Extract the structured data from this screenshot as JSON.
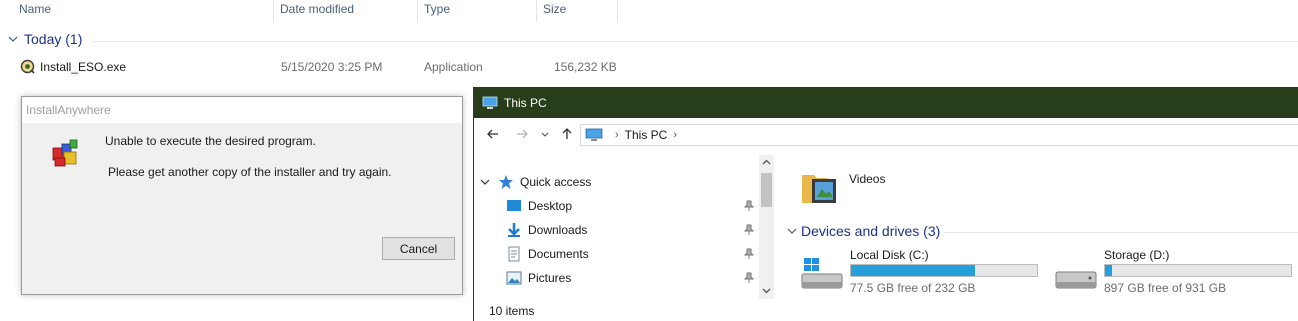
{
  "file_list": {
    "columns": [
      "Name",
      "Date modified",
      "Type",
      "Size"
    ],
    "group_label": "Today (1)",
    "row": {
      "name": "Install_ESO.exe",
      "date": "5/15/2020 3:25 PM",
      "type": "Application",
      "size": "156,232 KB",
      "icon": "installer-icon"
    }
  },
  "dialog": {
    "title": "InstallAnywhere",
    "message1": "Unable to execute the desired program.",
    "message2": "Please get another copy of the installer and try again.",
    "cancel_label": "Cancel",
    "icon": "installanywhere-icon"
  },
  "pc_window": {
    "title": "This PC",
    "title_bar_color": "#283d1a",
    "breadcrumb": [
      "This PC"
    ],
    "nav": {
      "quick_access": "Quick access",
      "items": [
        {
          "label": "Desktop",
          "icon": "desktop-icon"
        },
        {
          "label": "Downloads",
          "icon": "downloads-icon"
        },
        {
          "label": "Documents",
          "icon": "documents-icon"
        },
        {
          "label": "Pictures",
          "icon": "pictures-icon"
        }
      ]
    },
    "folder": {
      "label": "Videos",
      "icon": "videos-folder-icon"
    },
    "devices_header": "Devices and drives (3)",
    "drives": [
      {
        "name": "Local Disk (C:)",
        "free": "77.5 GB free of 232 GB",
        "used_fraction": 0.666,
        "icon": "windows-drive-icon"
      },
      {
        "name": "Storage (D:)",
        "free": "897 GB free of 931 GB",
        "used_fraction": 0.037,
        "icon": "hard-drive-icon"
      }
    ],
    "status": "10 items",
    "accent_color": "#26a0da"
  }
}
